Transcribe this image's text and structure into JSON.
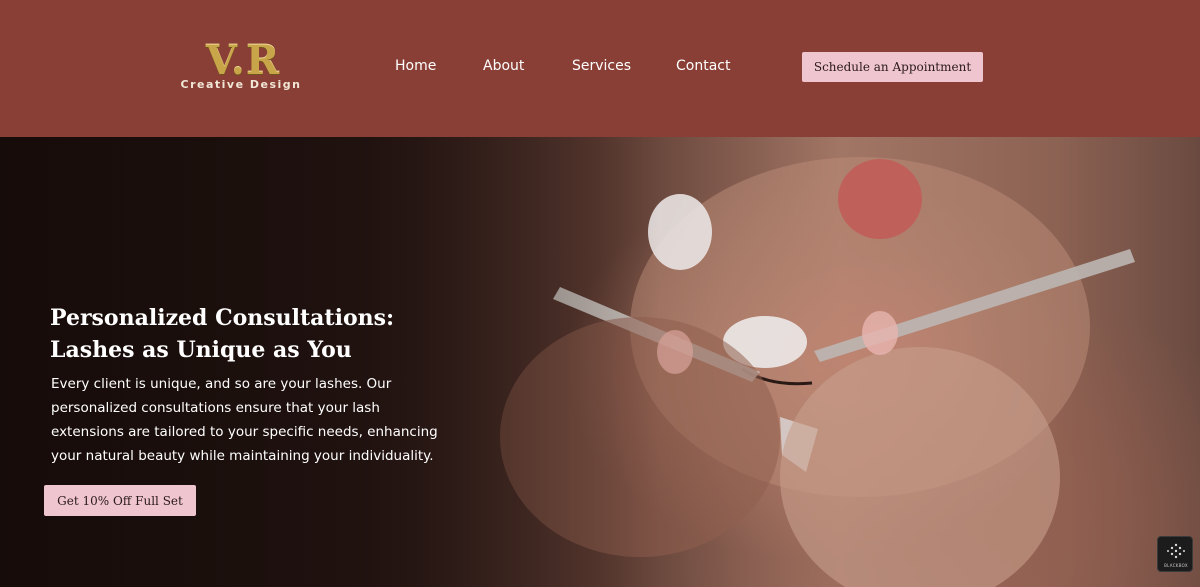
{
  "brand": {
    "logo_mark": "V.R",
    "logo_sub": "Creative Design",
    "logo_icon": "vr-logo"
  },
  "nav": {
    "items": [
      {
        "label": "Home"
      },
      {
        "label": "About"
      },
      {
        "label": "Services"
      },
      {
        "label": "Contact"
      }
    ],
    "cta_label": "Schedule an Appointment"
  },
  "hero": {
    "image": "lash-extension-application-photo",
    "title": "Personalized Consultations: Lashes as Unique as You",
    "body": "Every client is unique, and so are your lashes. Our personalized consultations ensure that your lash extensions are tailored to your specific needs, enhancing your natural beauty while maintaining your individuality.",
    "cta_label": "Get 10% Off Full Set"
  },
  "widget": {
    "icon": "blackbox-icon",
    "label": "BLACKBOX"
  },
  "colors": {
    "header_bg": "#8a3f36",
    "button_bg": "#efc5cf",
    "button_text": "#2a1a18",
    "logo_gold": "#c9a54a",
    "text_light": "#ffffff"
  }
}
